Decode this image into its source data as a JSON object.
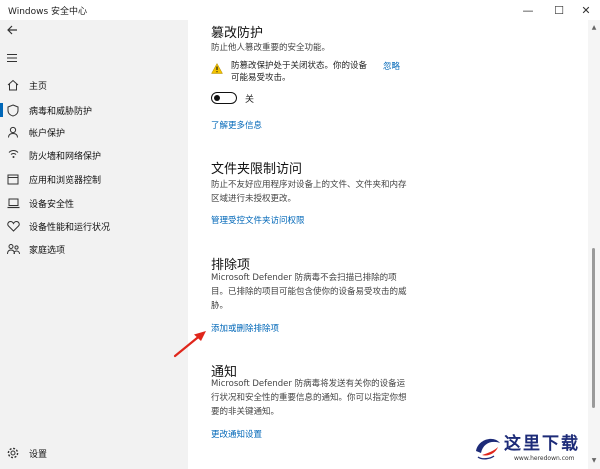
{
  "window": {
    "title": "Windows 安全中心",
    "controls": {
      "minimize": "—",
      "maximize": "☐",
      "close": "✕"
    }
  },
  "sidebar": {
    "back_icon": "back-arrow-icon",
    "menu_icon": "hamburger-icon",
    "items": [
      {
        "label": "主页",
        "icon": "home-icon"
      },
      {
        "label": "病毒和威胁防护",
        "icon": "shield-icon",
        "active": true
      },
      {
        "label": "帐户保护",
        "icon": "person-icon"
      },
      {
        "label": "防火墙和网络保护",
        "icon": "wifi-icon"
      },
      {
        "label": "应用和浏览器控制",
        "icon": "app-window-icon"
      },
      {
        "label": "设备安全性",
        "icon": "laptop-icon"
      },
      {
        "label": "设备性能和运行状况",
        "icon": "heart-icon"
      },
      {
        "label": "家庭选项",
        "icon": "family-icon"
      }
    ],
    "settings": {
      "label": "设置",
      "icon": "gear-icon"
    }
  },
  "tamper": {
    "title": "篡改防护",
    "description": "防止他人篡改重要的安全功能。",
    "warning_text": "防篡改保护处于关闭状态。你的设备可能易受攻击。",
    "warning_link": "忽略",
    "toggle_label": "关",
    "toggle_on": false,
    "learn_more": "了解更多信息"
  },
  "folder_access": {
    "title": "文件夹限制访问",
    "description": "防止不友好应用程序对设备上的文件、文件夹和内存区域进行未授权更改。",
    "link": "管理受控文件夹访问权限"
  },
  "exclusions": {
    "title": "排除项",
    "description": "Microsoft Defender 防病毒不会扫描已排除的项目。已排除的项目可能包含使你的设备易受攻击的威胁。",
    "link": "添加或删除排除项"
  },
  "notifications": {
    "title": "通知",
    "description": "Microsoft Defender 防病毒将发送有关你的设备运行状况和安全性的重要信息的通知。你可以指定你想要的非关键通知。",
    "link": "更改通知设置"
  },
  "watermark": {
    "text": "这里下载",
    "url": "www.heredown.com"
  },
  "colors": {
    "accent": "#0067b8",
    "sidebar_bg": "#f2f2f2",
    "warning": "#f2c200",
    "annotation_arrow": "#e0261b"
  }
}
